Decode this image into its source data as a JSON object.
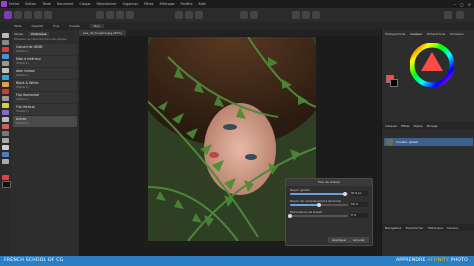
{
  "menu": {
    "items": [
      "Fichier",
      "Édition",
      "Texte",
      "Document",
      "Calque",
      "Sélectionner",
      "Organiser",
      "Filtres",
      "Affichage",
      "Fenêtre",
      "Aide"
    ]
  },
  "context_bar": {
    "items": [
      "Taille",
      "Opacité",
      "Flux",
      "Dureté"
    ],
    "button": "Plus"
  },
  "left_panel": {
    "tabs": [
      "Styles",
      "Historique"
    ],
    "note": "Pinceau de reproduction des styles",
    "items": [
      {
        "title": "Conseil de dRGB",
        "sub": "(Pixels 1)"
      },
      {
        "title": "Mise à Intérieur",
        "sub": "(Pixels 1)"
      },
      {
        "title": "Adm Inelaw",
        "sub": "(Pixels 1)"
      },
      {
        "title": "Black & White",
        "sub": "(Pixels 1)"
      },
      {
        "title": "Flip Horizontal",
        "sub": "(Pixels 1)"
      },
      {
        "title": "Flip Vertical",
        "sub": "(Pixels 1)"
      },
      {
        "title": "Autres",
        "sub": "(Pixels 1)"
      }
    ]
  },
  "document": {
    "tab": "pas_de_fougère.jpg (60%)"
  },
  "right_panel": {
    "tabs": [
      "Histogramme",
      "Couleur",
      "Échantillons",
      "Pinceaux"
    ],
    "layer_tabs": [
      "Calques",
      "Effets",
      "Styles",
      "Mixage"
    ],
    "layer_name": "Couleur (pixel)",
    "nav_tabs": [
      "Navigateur",
      "Transformer",
      "Historique",
      "Canaux"
    ],
    "wheel_colors": [
      "#ff0000",
      "#ffff00",
      "#00ff00",
      "#00ffff",
      "#0000ff",
      "#ff00ff"
    ],
    "swatch_primary": "#ff4a4a",
    "swatch_secondary": "#000000"
  },
  "dialog": {
    "title": "Flou de champ",
    "rows": [
      {
        "label": "Rayon global",
        "value": "97,6 px",
        "percent": 0.95
      },
      {
        "label": "Rayon de remplacement de bords",
        "value": "50 %",
        "percent": 0.5
      },
      {
        "label": "Dimensions de bokeh",
        "value": "0 %",
        "percent": 0.0
      }
    ],
    "apply": "Appliquer",
    "cancel": "Annuler"
  },
  "footer": {
    "left": "FRENCH SCHOOL OF CG",
    "right_prefix": "APPRENDRE",
    "right_highlight": "AFFINITY",
    "right_suffix": "PHOTO"
  }
}
